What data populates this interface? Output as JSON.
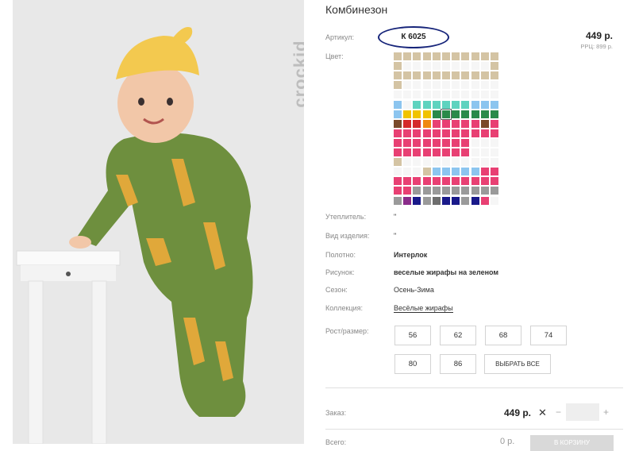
{
  "product": {
    "title": "Комбинезон",
    "brand": "crockid",
    "article_label": "Артикул:",
    "article_value": "К 6025",
    "price": "449 р.",
    "rrc": "РРЦ: 899 р.",
    "color_label": "Цвет:"
  },
  "attributes": [
    {
      "label": "Утеплитель:",
      "value": "\"",
      "bold": false
    },
    {
      "label": "Вид изделия:",
      "value": "\"",
      "bold": false
    },
    {
      "label": "Полотно:",
      "value": "Интерлок",
      "bold": true
    },
    {
      "label": "Рисунок:",
      "value": "веселые жирафы на зеленом",
      "bold": true
    },
    {
      "label": "Сезон:",
      "value": "Осень-Зима",
      "bold": false
    },
    {
      "label": "Коллекция:",
      "value": "Весёлые жирафы",
      "bold": false
    }
  ],
  "sizes": {
    "label": "Рост/размер:",
    "items": [
      "56",
      "62",
      "68",
      "74",
      "80",
      "86"
    ],
    "select_all": "ВЫБРАТЬ ВСЕ"
  },
  "order": {
    "label": "Заказ:",
    "price": "449 р.",
    "clear": "✕",
    "minus": "−",
    "plus": "+",
    "total_label": "Всего:",
    "total_value": "0 р.",
    "cart_button": "В КОРЗИНУ"
  },
  "palette": {
    "T": "#d4c4a4",
    "W": "#f6f6f6",
    "M": "#5ed3bf",
    "L": "#8cc5ef",
    "Y": "#f0c300",
    "G": "#2a8a4a",
    "B": "#7a4a2a",
    "R": "#d42a2a",
    "O": "#ef8a10",
    "P": "#e84073",
    "S": "#9a9a9a",
    "N": "#1a1a8a",
    "U": "#8a2c8a",
    "D": "#6e6e6e"
  },
  "swatch_rows": [
    "TTTTTTTTTTT",
    "TWWWWWWWWWT",
    "TTTTTTTTTTT",
    "TWWWWWWWWWW",
    "WWWWWWWWWWW",
    "LWMMMMMMLLL",
    "LYYYGGGGGGG",
    "BRROPPPPPBP",
    "PPPPPPPPPPP",
    "PPPPPPPPWWW",
    "PPPPPPPPWWW",
    "TWWWWWWWWWW",
    "WWWTLLLLLPP",
    "PPPPPPPPPPP",
    "PPSSSSSSSSS",
    "SUNSDNNSNPW"
  ],
  "selected_swatch": "6-5"
}
